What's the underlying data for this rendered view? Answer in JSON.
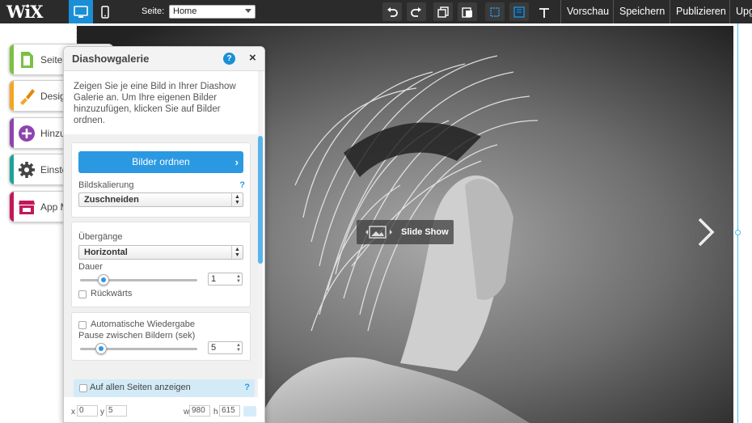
{
  "topbar": {
    "logo": "WiX",
    "page_label": "Seite:",
    "page_value": "Home",
    "links": [
      "Vorschau",
      "Speichern",
      "Publizieren",
      "Upg"
    ]
  },
  "left_menu": [
    {
      "label": "Seiten",
      "icon": "page-icon",
      "color": "#7ac142"
    },
    {
      "label": "Design",
      "icon": "brush-icon",
      "color": "#f5a623"
    },
    {
      "label": "Hinzufügen",
      "icon": "plus-circle-icon",
      "color": "#8e44ad"
    },
    {
      "label": "Einstellungen",
      "icon": "gear-icon",
      "color": "#1aa39a"
    },
    {
      "label": "App Market",
      "icon": "store-icon",
      "color": "#c2185b"
    }
  ],
  "canvas": {
    "slideshow_label": "Slide Show"
  },
  "panel": {
    "title": "Diashowgalerie",
    "help": "?",
    "close": "×",
    "description": "Zeigen Sie je eine Bild in Ihrer Diashow Galerie an. Um Ihre eigenen Bilder hinzuzufügen, klicken Sie auf Bilder ordnen.",
    "bilder_button": "Bilder ordnen",
    "bildskalierung_label": "Bildskalierung",
    "bildskalierung_value": "Zuschneiden",
    "uebergaenge_label": "Übergänge",
    "uebergaenge_value": "Horizontal",
    "dauer_label": "Dauer",
    "dauer_value": "1",
    "dauer_slider": 0.2,
    "rueckwaerts_label": "Rückwärts",
    "autoplay_label": "Automatische Wiedergabe",
    "pause_label": "Pause zwischen Bildern (sek)",
    "pause_value": "5",
    "pause_slider": 0.18,
    "allpages_label": "Auf allen Seiten anzeigen",
    "allpages_help": "?",
    "footer": {
      "x_label": "x",
      "x_value": "0",
      "y_label": "y",
      "y_value": "5",
      "w_label": "w",
      "w_value": "980",
      "h_label": "h",
      "h_value": "615"
    }
  },
  "colors": {
    "accent": "#2b99e2",
    "topbar": "#2b2b2b"
  }
}
